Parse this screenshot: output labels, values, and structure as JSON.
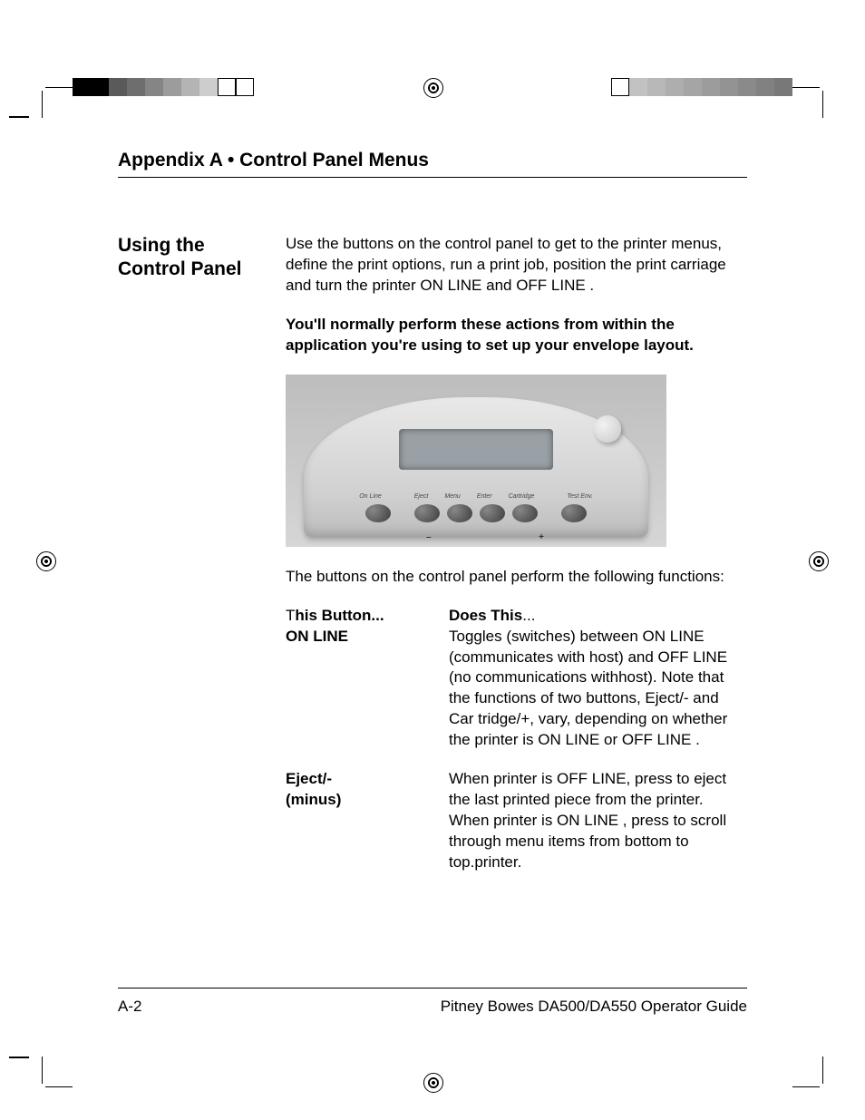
{
  "header": {
    "appendix_title": "Appendix A  •   Control Panel Menus"
  },
  "side": {
    "section_title": "Using the Control Panel"
  },
  "main": {
    "intro": "Use the buttons on the control panel to get to the printer menus, define the print options, run a print job, position the print carriage and turn the printer ON LINE  and OFF LINE .",
    "note": "You'll normally perform these actions from within the application you're using to set up your envelope layout.",
    "after_photo": "The buttons on the control panel perform the following functions:"
  },
  "panel_labels": {
    "on_line": "On Line",
    "eject": "Eject",
    "menu": "Menu",
    "enter": "Enter",
    "cartridge": "Cartridge",
    "test_env": "Test Env.",
    "minus": "–",
    "plus": "+"
  },
  "table": {
    "hdr_left_prefix": "T",
    "hdr_left": "his Button...",
    "hdr_right": "Does This",
    "hdr_right_suffix": "...",
    "rows": [
      {
        "button": "ON LINE",
        "desc": "Toggles (switches) between ON LINE  (communicates with host) and OFF LINE  (no communications withhost). Note that the functions of two buttons, Eject/- and Car tridge/+, vary, depending on whether the printer is ON LINE  or OFF LINE ."
      },
      {
        "button": "Eject/-\n (minus)",
        "desc": "When printer is OFF LINE, press to eject the last printed piece from the printer. When printer is ON LINE , press to scroll through menu items from bottom to top.printer."
      }
    ]
  },
  "footer": {
    "page": "A-2",
    "guide": "Pitney Bowes DA500/DA550 Operator Guide"
  },
  "reg_colors_left": [
    "#000",
    "#000",
    "#5a5a5a",
    "#6e6e6e",
    "#858585",
    "#9c9c9c",
    "#b4b4b4",
    "#cdcdcd",
    "#fff",
    "#fff"
  ],
  "reg_colors_right": [
    "#fff",
    "#c2c2c2",
    "#b8b8b8",
    "#aeaeae",
    "#a5a5a5",
    "#9c9c9c",
    "#939393",
    "#8a8a8a",
    "#818181",
    "#787878"
  ]
}
